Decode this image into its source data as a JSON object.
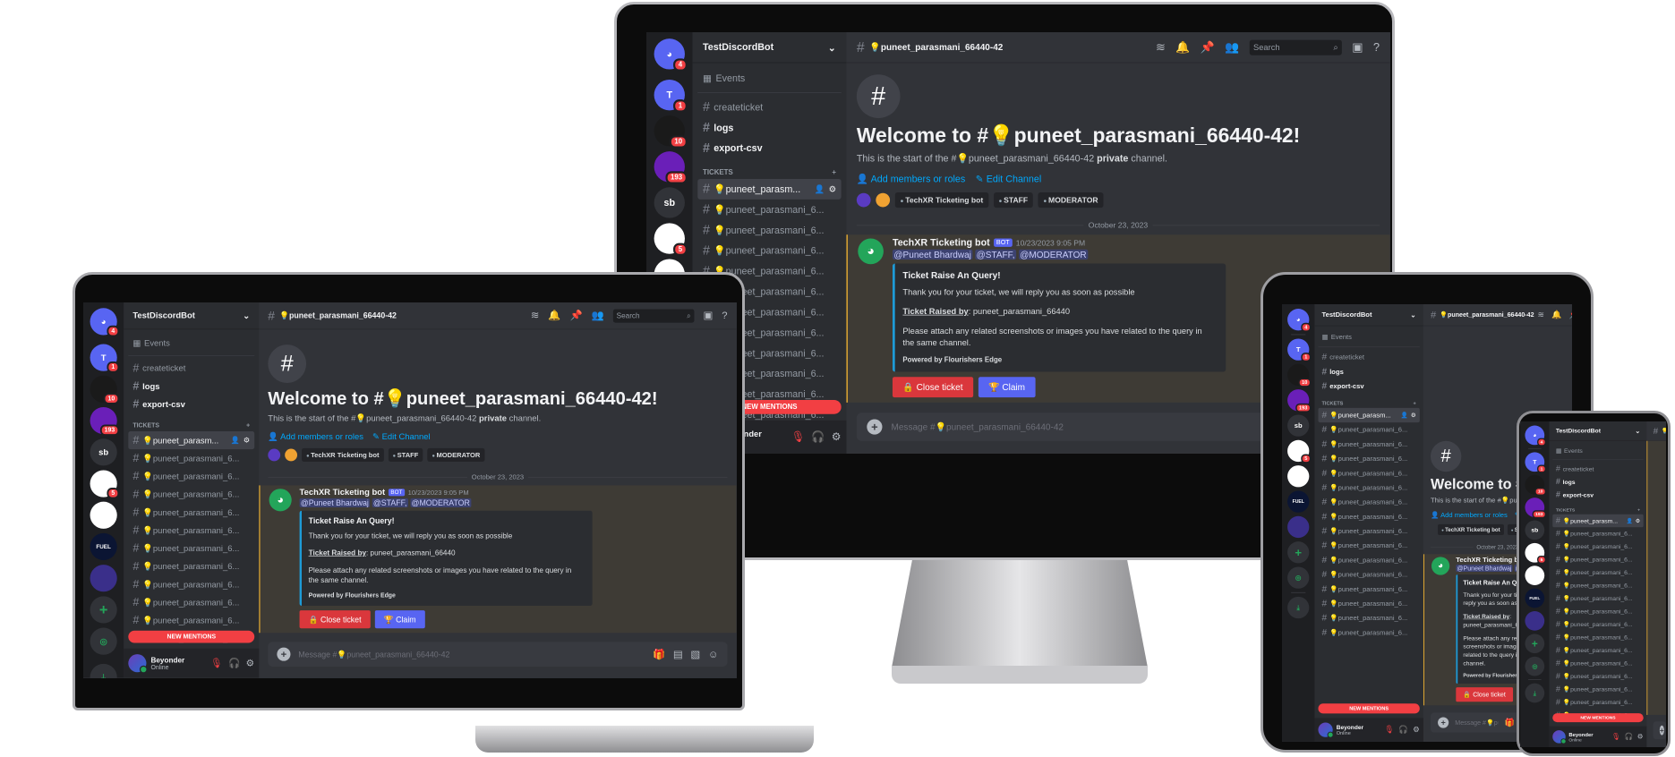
{
  "colors": {
    "brand": "#5865f2",
    "danger": "#da373c",
    "online": "#23a55a",
    "mention_highlight": "#f0b232",
    "link": "#00a8fc"
  },
  "server": {
    "name": "TestDiscordBot"
  },
  "rail": {
    "home_badge": "4",
    "servers": [
      {
        "label": "T",
        "badge": "1",
        "color": "#5865f2"
      },
      {
        "label": "",
        "badge": "10",
        "color": "#1a1a1a"
      },
      {
        "label": "",
        "badge": "193",
        "color": "#6a1fb8"
      },
      {
        "label": "sb",
        "badge": "",
        "color": "#313338"
      },
      {
        "label": "",
        "badge": "5",
        "color": "#ffffff"
      },
      {
        "label": "",
        "badge": "",
        "color": "#ffffff"
      },
      {
        "label": "FUEL",
        "badge": "",
        "color": "#0b1533"
      },
      {
        "label": "",
        "badge": "",
        "color": "#3a2f8a"
      }
    ]
  },
  "sidebar": {
    "events": "Events",
    "channels": [
      "createticket",
      "logs",
      "export-csv"
    ],
    "category": "TICKETS",
    "tickets": [
      "💡puneet_parasm...",
      "💡puneet_parasmani_6...",
      "💡puneet_parasmani_6...",
      "💡puneet_parasmani_6...",
      "💡puneet_parasmani_6...",
      "💡puneet_parasmani_6...",
      "💡puneet_parasmani_6...",
      "💡puneet_parasmani_6...",
      "💡puneet_parasmani_6...",
      "💡puneet_parasmani_6...",
      "💡puneet_parasmani_6...",
      "💡puneet_parasmani_6...",
      "💡puneet_parasmani_6...",
      "💡puneet_parasmani_6...",
      "💡puneet_parasmani_6...",
      "💡puneet_parasmani_6..."
    ],
    "new_mentions": "NEW MENTIONS"
  },
  "user": {
    "name": "Beyonder",
    "status": "Online"
  },
  "header": {
    "channel": "💡puneet_parasmani_66440-42",
    "search_placeholder": "Search"
  },
  "welcome": {
    "title": "Welcome to #💡puneet_parasmani_66440-42!",
    "start": "This is the start of the #",
    "channel": "💡puneet_parasmani_66440-42",
    "private": "private",
    "end": "channel.",
    "add_members": "Add members or roles",
    "edit_channel": "Edit Channel",
    "roles": [
      "TechXR Ticketing bot",
      "STAFF",
      "MODERATOR"
    ]
  },
  "date_divider": "October 23, 2023",
  "message": {
    "author": "TechXR Ticketing bot",
    "badge": "BOT",
    "time": "10/23/2023 9:05 PM",
    "mentions": [
      "@Puneet Bhardwaj",
      "@STAFF,",
      "@MODERATOR"
    ],
    "embed": {
      "title": "Ticket Raise An Query!",
      "line1": "Thank you for your ticket, we will reply you as soon as possible",
      "raised_label": "Ticket Raised by",
      "raised_value": ": puneet_parasmani_66440",
      "line3": "Please attach any related screenshots or images you have related to the query in the same channel.",
      "footer": "Powered by Flourishers Edge"
    },
    "buttons": {
      "close": "Close ticket",
      "claim": "Claim"
    }
  },
  "composer": {
    "placeholder": "Message #💡puneet_parasmani_66440-42"
  }
}
